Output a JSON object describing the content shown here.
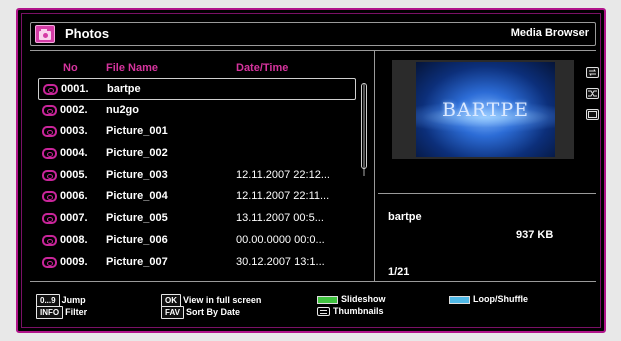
{
  "header": {
    "title": "Photos",
    "right_label": "Media Browser"
  },
  "columns": {
    "no": "No",
    "file_name": "File Name",
    "date_time": "Date/Time"
  },
  "files": [
    {
      "no": "0001.",
      "name": "bartpe",
      "date": ""
    },
    {
      "no": "0002.",
      "name": "nu2go",
      "date": ""
    },
    {
      "no": "0003.",
      "name": "Picture_001",
      "date": ""
    },
    {
      "no": "0004.",
      "name": "Picture_002",
      "date": ""
    },
    {
      "no": "0005.",
      "name": "Picture_003",
      "date": "12.11.2007 22:12..."
    },
    {
      "no": "0006.",
      "name": "Picture_004",
      "date": "12.11.2007 22:11..."
    },
    {
      "no": "0007.",
      "name": "Picture_005",
      "date": "13.11.2007 00:5..."
    },
    {
      "no": "0008.",
      "name": "Picture_006",
      "date": "00.00.0000 00:0..."
    },
    {
      "no": "0009.",
      "name": "Picture_007",
      "date": "30.12.2007 13:1..."
    }
  ],
  "preview": {
    "logo_text": "BARTPE"
  },
  "info": {
    "name": "bartpe",
    "size": "937 KB",
    "page": "1/21"
  },
  "side_icons": [
    "repeat-icon",
    "shuffle-icon",
    "fullscreen-icon"
  ],
  "legend": {
    "jump_key": "0...9",
    "jump": "Jump",
    "info_key": "INFO",
    "filter": "Filter",
    "ok_key": "OK",
    "view_full": "View in full screen",
    "fav_key": "FAV",
    "sort": "Sort By Date",
    "slideshow": "Slideshow",
    "thumbnails": "Thumbnails",
    "loop": "Loop/Shuffle"
  },
  "colors": {
    "accent": "#d6349e",
    "border": "#b0148a",
    "slideshow": "#3fc23f",
    "loop": "#4fb8e6"
  }
}
